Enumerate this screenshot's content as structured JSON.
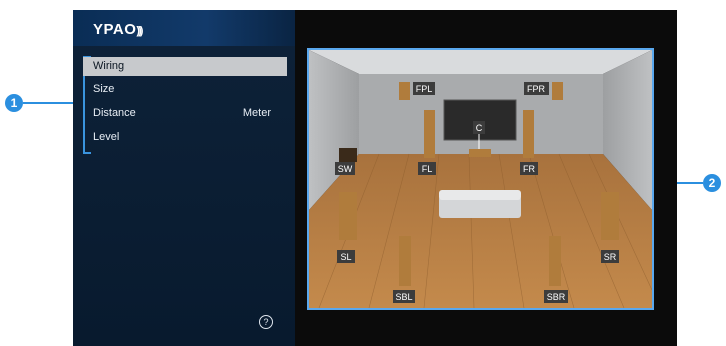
{
  "app": {
    "logo": "YPAO"
  },
  "menu": {
    "items": [
      {
        "label": "Wiring",
        "value": ""
      },
      {
        "label": "Size",
        "value": ""
      },
      {
        "label": "Distance",
        "value": "Meter"
      },
      {
        "label": "Level",
        "value": ""
      }
    ],
    "selected": "Wiring"
  },
  "help": {
    "glyph": "?"
  },
  "callouts": {
    "left": "1",
    "right": "2"
  },
  "speakers": {
    "FPL": "FPL",
    "FPR": "FPR",
    "C": "C",
    "FL": "FL",
    "FR": "FR",
    "SW": "SW",
    "SL": "SL",
    "SR": "SR",
    "SBL": "SBL",
    "SBR": "SBR"
  },
  "colors": {
    "accent": "#2b8fdf",
    "selection": "#c7c9cc",
    "panel": "#0e2239"
  }
}
